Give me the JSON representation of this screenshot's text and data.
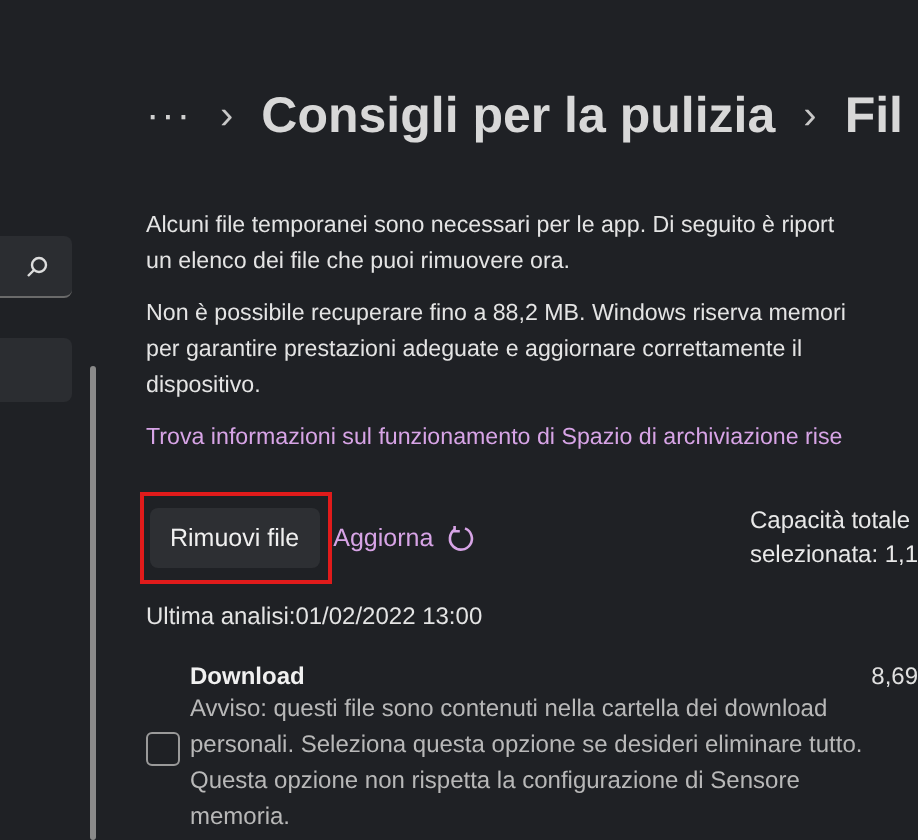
{
  "breadcrumb": {
    "more": "···",
    "separators": [
      "›",
      "›"
    ],
    "items": [
      "Consigli per la pulizia",
      "Fil"
    ]
  },
  "intro": [
    {
      "kind": "text",
      "lines": [
        "Alcuni file temporanei sono necessari per le app. Di seguito è riport",
        "un elenco dei file che puoi rimuovere ora."
      ]
    },
    {
      "kind": "text",
      "lines": [
        "Non è possibile recuperare fino a 88,2 MB. Windows riserva memori",
        "per garantire prestazioni adeguate e aggiornare correttamente il",
        "dispositivo."
      ]
    },
    {
      "kind": "link",
      "lines": [
        "Trova informazioni sul funzionamento di Spazio di archiviazione rise"
      ]
    }
  ],
  "actions": {
    "remove_button": {
      "label": "Rimuovi file",
      "highlighted": true
    },
    "refresh_link": "Aggiorna",
    "capacity": [
      "Capacità totale",
      "selezionata: 1,1"
    ]
  },
  "last_scan": "Ultima analisi:01/02/2022 13:00",
  "items": [
    {
      "title": "Download",
      "size": "8,69",
      "checked": false,
      "description": [
        "Avviso: questi file sono contenuti nella cartella dei download",
        "personali. Seleziona questa opzione se desideri eliminare tutto.",
        "Questa opzione non rispetta la configurazione di Sensore",
        "memoria."
      ]
    }
  ]
}
